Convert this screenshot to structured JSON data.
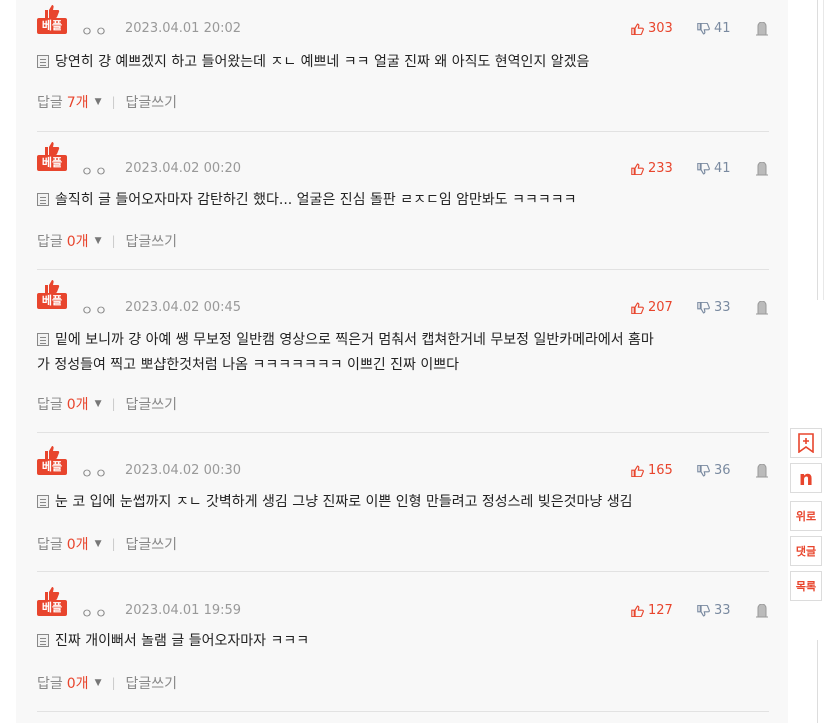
{
  "colors": {
    "accent": "#e8452d",
    "panel": "#f8f8f8",
    "dislike": "#7a8aa0"
  },
  "comments": [
    {
      "badge": "베플",
      "author": "ㅇㅇ",
      "date": "2023.04.01 20:02",
      "likes": "303",
      "dislikes": "41",
      "text": "당연히 걍 예쁘겠지 하고 들어왔는데 ㅈㄴ 예쁘네 ㅋㅋ 얼굴 진짜 왜 아직도 현역인지 알겠음",
      "reply_label": "답글",
      "reply_count": "7개",
      "write_reply": "답글쓰기"
    },
    {
      "badge": "베플",
      "author": "ㅇㅇ",
      "date": "2023.04.02 00:20",
      "likes": "233",
      "dislikes": "41",
      "text": "솔직히 글 들어오자마자 감탄하긴 했다... 얼굴은 진심 돌판 ㄹㅈㄷ임 암만봐도 ㅋㅋㅋㅋㅋ",
      "reply_label": "답글",
      "reply_count": "0개",
      "write_reply": "답글쓰기"
    },
    {
      "badge": "베플",
      "author": "ㅇㅇ",
      "date": "2023.04.02 00:45",
      "likes": "207",
      "dislikes": "33",
      "text_line1": "밑에 보니까 걍 아예 쌩 무보정 일반캠 영상으로 찍은거 멈춰서 캡쳐한거네 무보정 일반카메라에서 홈마",
      "text_line2": "가 정성들여 찍고 뽀샵한것처럼 나옴 ㅋㅋㅋㅋㅋㅋㅋ 이쁘긴 진짜 이쁘다",
      "reply_label": "답글",
      "reply_count": "0개",
      "write_reply": "답글쓰기"
    },
    {
      "badge": "베플",
      "author": "ㅇㅇ",
      "date": "2023.04.02 00:30",
      "likes": "165",
      "dislikes": "36",
      "text": "눈 코 입에 눈썹까지 ㅈㄴ 갓벽하게 생김 그냥 진짜로 이쁜 인형 만들려고 정성스레 빚은것마냥 생김",
      "reply_label": "답글",
      "reply_count": "0개",
      "write_reply": "답글쓰기"
    },
    {
      "badge": "베플",
      "author": "ㅇㅇ",
      "date": "2023.04.01 19:59",
      "likes": "127",
      "dislikes": "33",
      "text": "진짜 개이뻐서 놀램 글 들어오자마자 ㅋㅋㅋ",
      "reply_label": "답글",
      "reply_count": "0개",
      "write_reply": "답글쓰기"
    }
  ],
  "side": {
    "bookmark_icon": "bookmark-plus-icon",
    "n_logo": "n",
    "comfort": "위로",
    "comments": "댓글",
    "list": "목록"
  }
}
